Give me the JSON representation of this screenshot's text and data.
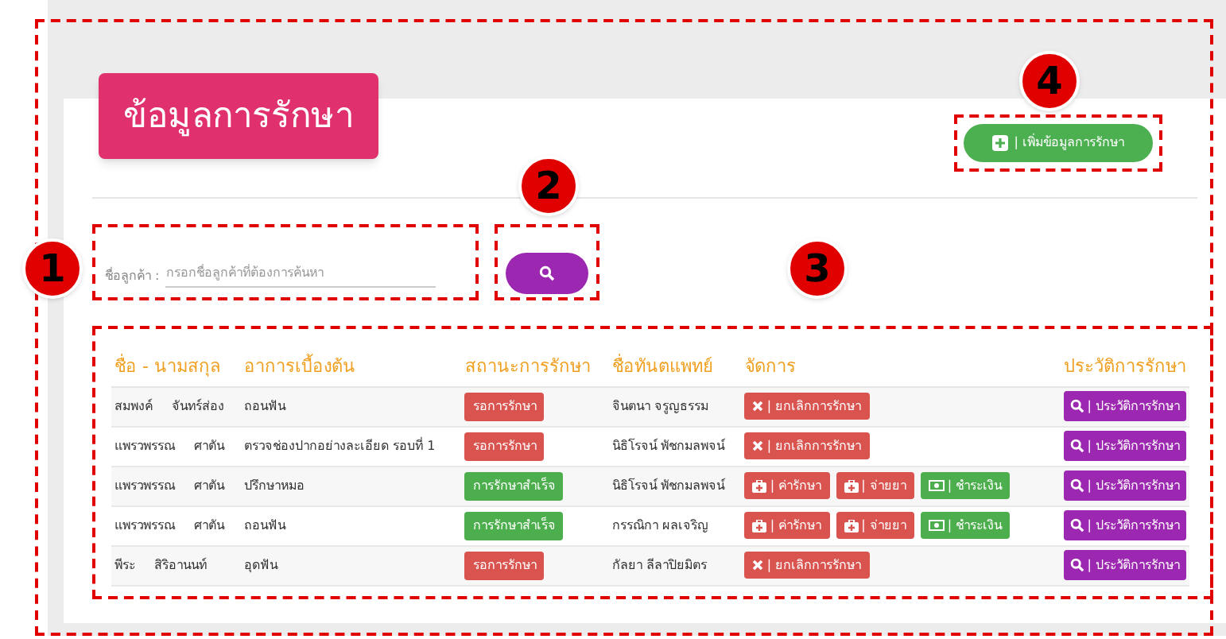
{
  "title": "ข้อมูลการรักษา",
  "add_button": {
    "label": "| เพิ่มข้อมูลการรักษา"
  },
  "search": {
    "label": "ชื่อลูกค้า :",
    "placeholder": "กรอกชื่อลูกค้าที่ต้องการค้นหา"
  },
  "table": {
    "columns": [
      "ชื่อ - นามสกุล",
      "อาการเบื้องต้น",
      "สถานะการรักษา",
      "ชื่อทันตแพทย์",
      "จัดการ",
      "ประวัติการรักษา"
    ],
    "rows": [
      {
        "first_name": "สมพงค์",
        "last_name": "จันทร์ส่อง",
        "symptom": "ถอนฟัน",
        "status": {
          "kind": "waiting",
          "label": "รอการรักษา"
        },
        "dentist": "จินตนา จรูญธรรม",
        "actions": [
          {
            "kind": "cancel",
            "label": "| ยกเลิกการรักษา"
          }
        ],
        "history": "| ประวัติการรักษา"
      },
      {
        "first_name": "แพรวพรรณ",
        "last_name": "ศาตัน",
        "symptom": "ตรวจช่องปากอย่างละเอียด รอบที่ 1",
        "status": {
          "kind": "waiting",
          "label": "รอการรักษา"
        },
        "dentist": "นิธิโรจน์ พัชกมลพจน์",
        "actions": [
          {
            "kind": "cancel",
            "label": "| ยกเลิกการรักษา"
          }
        ],
        "history": "| ประวัติการรักษา"
      },
      {
        "first_name": "แพรวพรรณ",
        "last_name": "ศาตัน",
        "symptom": "ปรึกษาหมอ",
        "status": {
          "kind": "done",
          "label": "การรักษาสำเร็จ"
        },
        "dentist": "นิธิโรจน์ พัชกมลพจน์",
        "actions": [
          {
            "kind": "fee",
            "label": "| ค่ารักษา"
          },
          {
            "kind": "medicine",
            "label": "| จ่ายยา"
          },
          {
            "kind": "pay",
            "label": "| ชำระเงิน"
          }
        ],
        "history": "| ประวัติการรักษา"
      },
      {
        "first_name": "แพรวพรรณ",
        "last_name": "ศาตัน",
        "symptom": "ถอนฟัน",
        "status": {
          "kind": "done",
          "label": "การรักษาสำเร็จ"
        },
        "dentist": "กรรณิกา ผลเจริญ",
        "actions": [
          {
            "kind": "fee",
            "label": "| ค่ารักษา"
          },
          {
            "kind": "medicine",
            "label": "| จ่ายยา"
          },
          {
            "kind": "pay",
            "label": "| ชำระเงิน"
          }
        ],
        "history": "| ประวัติการรักษา"
      },
      {
        "first_name": "พีระ",
        "last_name": "สิริอานนท์",
        "symptom": "อุดฟัน",
        "status": {
          "kind": "waiting",
          "label": "รอการรักษา"
        },
        "dentist": "กัลยา ลีลาปิยมิตร",
        "actions": [
          {
            "kind": "cancel",
            "label": "| ยกเลิกการรักษา"
          }
        ],
        "history": "| ประวัติการรักษา"
      }
    ]
  },
  "callouts": [
    "1",
    "2",
    "3",
    "4"
  ]
}
